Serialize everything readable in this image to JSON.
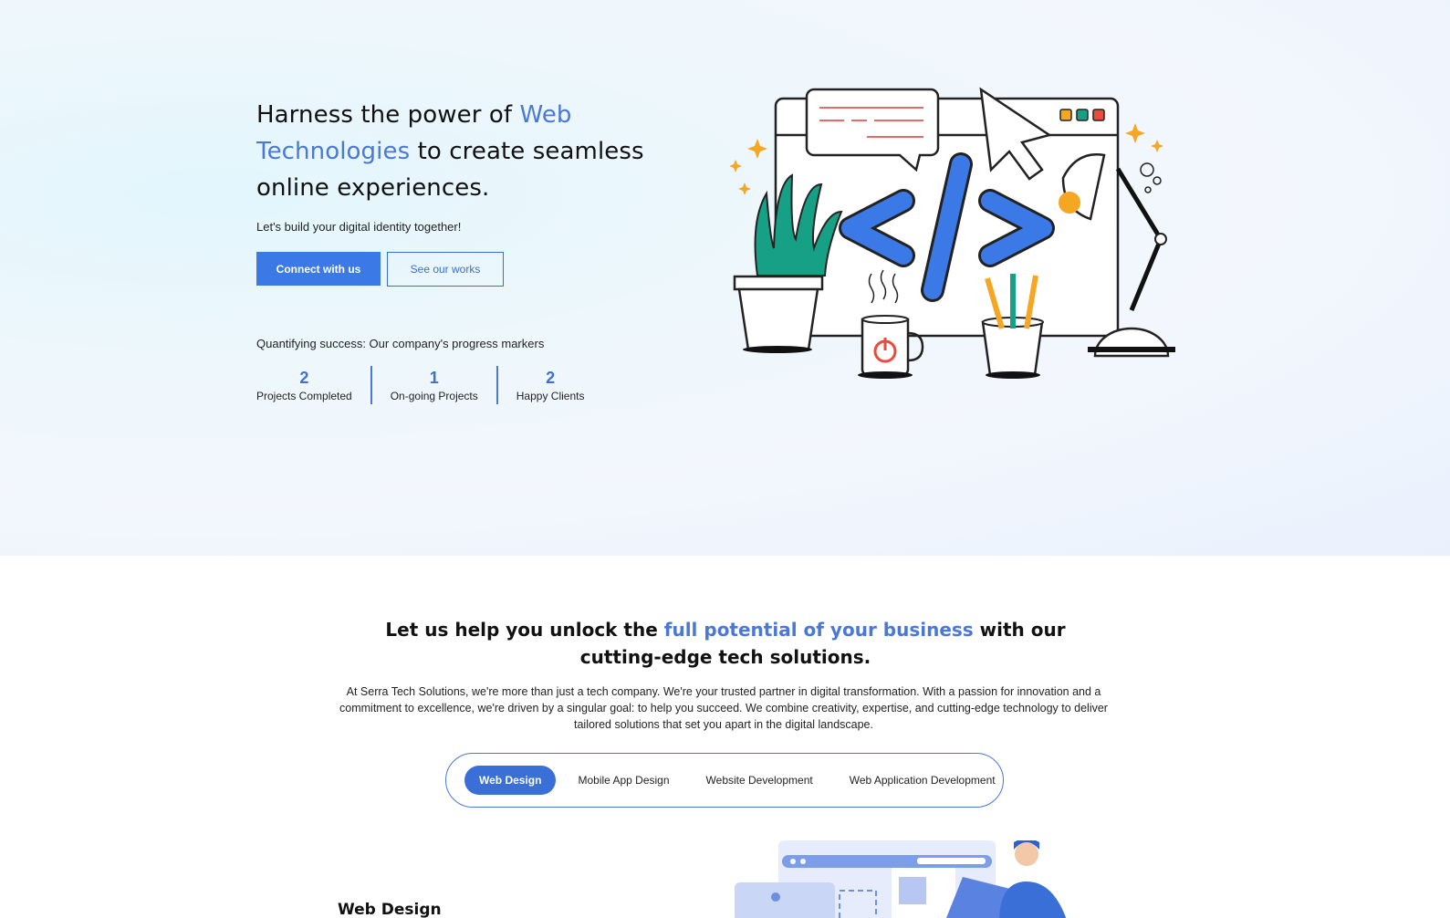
{
  "hero": {
    "headline_part1": "Harness the power of ",
    "headline_accent": "Web Technologies",
    "headline_part2": " to create seamless online experiences.",
    "tagline": "Let's build your digital identity together!",
    "primary_button": "Connect with us",
    "secondary_button": "See our works",
    "stats_title": "Quantifying success: Our company's progress markers",
    "stats": [
      {
        "value": "2",
        "label": "Projects Completed"
      },
      {
        "value": "1",
        "label": "On-going Projects"
      },
      {
        "value": "2",
        "label": "Happy Clients"
      }
    ]
  },
  "section2": {
    "heading_part1": "Let us help you unlock the ",
    "heading_accent": "full potential of your business",
    "heading_part2": " with our cutting-edge tech solutions.",
    "body": "At Serra Tech Solutions, we're more than just a tech company. We're your trusted partner in digital transformation. With a passion for innovation and a commitment to excellence, we're driven by a singular goal: to help you succeed. We combine creativity, expertise, and cutting-edge technology to deliver tailored solutions that set you apart in the digital landscape.",
    "tabs": [
      "Web Design",
      "Mobile App Design",
      "Website Development",
      "Web Application Development"
    ],
    "active_tab": "Web Design",
    "sub_heading": "Web Design"
  },
  "colors": {
    "accent": "#4a78d6",
    "button": "#3b7ae6",
    "active_tab": "#3b6fd8"
  },
  "icons": [
    "code-illustration",
    "web-design-illustration"
  ]
}
